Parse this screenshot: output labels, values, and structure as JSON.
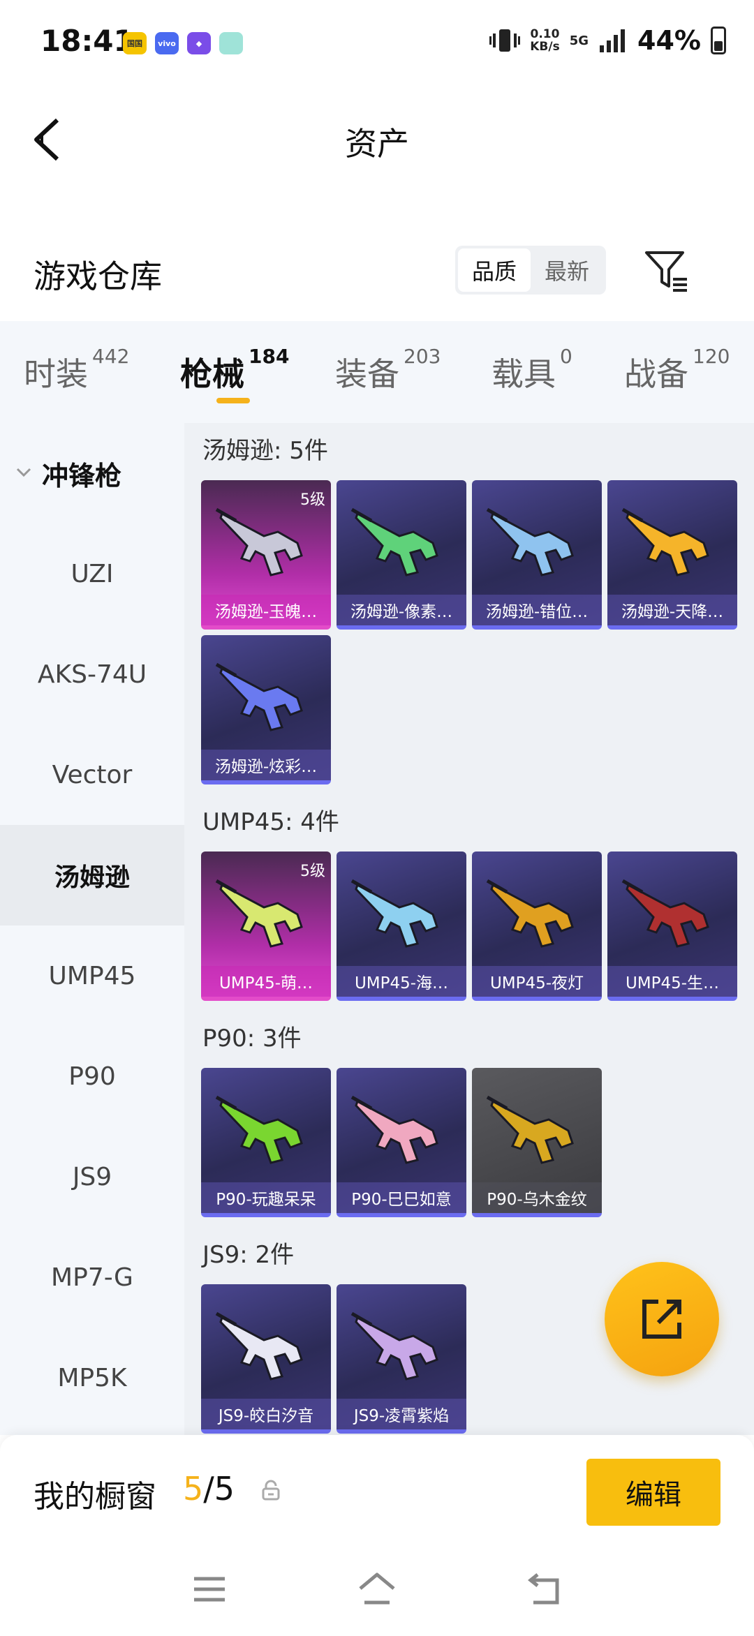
{
  "status": {
    "time": "18:41",
    "apps": [
      {
        "name": "app-icon-1",
        "label": "国国",
        "color": "#f5c400"
      },
      {
        "name": "app-icon-2",
        "label": "vivo",
        "color": "#4a6af0"
      },
      {
        "name": "app-icon-3",
        "label": "◆",
        "color": "#7a4de8"
      },
      {
        "name": "app-icon-4",
        "label": "",
        "color": "#9fe3d8"
      }
    ],
    "net_speed": "0.10",
    "net_unit": "KB/s",
    "network": "5G",
    "battery": "44%"
  },
  "header": {
    "title": "资产"
  },
  "warehouse": {
    "title": "游戏仓库",
    "sort_options": [
      "品质",
      "最新"
    ],
    "sort_active": "品质"
  },
  "tabs": [
    {
      "label": "时装",
      "count": "442"
    },
    {
      "label": "枪械",
      "count": "184"
    },
    {
      "label": "装备",
      "count": "203"
    },
    {
      "label": "载具",
      "count": "0"
    },
    {
      "label": "战备",
      "count": "120"
    }
  ],
  "sidebar": {
    "group": "冲锋枪",
    "items": [
      "UZI",
      "AKS-74U",
      "Vector",
      "汤姆逊",
      "UMP45",
      "P90",
      "JS9",
      "MP7-G",
      "MP5K"
    ],
    "active": "汤姆逊"
  },
  "groups": [
    {
      "title": "汤姆逊: 5件",
      "items": [
        {
          "name": "汤姆逊-玉魄…",
          "level": "5级",
          "rarity": "pink",
          "color": "#c8c8d8"
        },
        {
          "name": "汤姆逊-像素…",
          "level": "",
          "rarity": "purple",
          "color": "#5fd27a"
        },
        {
          "name": "汤姆逊-错位…",
          "level": "",
          "rarity": "purple",
          "color": "#8fc3ef"
        },
        {
          "name": "汤姆逊-天降…",
          "level": "",
          "rarity": "purple",
          "color": "#f5b42a"
        },
        {
          "name": "汤姆逊-炫彩…",
          "level": "",
          "rarity": "purple",
          "color": "#6a7af0"
        }
      ]
    },
    {
      "title": "UMP45: 4件",
      "items": [
        {
          "name": "UMP45-萌…",
          "level": "5级",
          "rarity": "pink",
          "color": "#d8e870"
        },
        {
          "name": "UMP45-海…",
          "level": "",
          "rarity": "purple",
          "color": "#8ed0f0"
        },
        {
          "name": "UMP45-夜灯",
          "level": "",
          "rarity": "purple",
          "color": "#e0a020"
        },
        {
          "name": "UMP45-生…",
          "level": "",
          "rarity": "purple",
          "color": "#b03030"
        }
      ]
    },
    {
      "title": "P90: 3件",
      "items": [
        {
          "name": "P90-玩趣呆呆",
          "level": "",
          "rarity": "purple",
          "color": "#7ad630"
        },
        {
          "name": "P90-巳巳如意",
          "level": "",
          "rarity": "purple",
          "color": "#f0a8c0"
        },
        {
          "name": "P90-乌木金纹",
          "level": "",
          "rarity": "gray",
          "color": "#d8a820"
        }
      ]
    },
    {
      "title": "JS9: 2件",
      "items": [
        {
          "name": "JS9-皎白汐音",
          "level": "",
          "rarity": "purple",
          "color": "#e8e8f4"
        },
        {
          "name": "JS9-凌霄紫焰",
          "level": "",
          "rarity": "purple",
          "color": "#c8a8e8"
        }
      ]
    }
  ],
  "showcase": {
    "label": "我的橱窗",
    "current": "5",
    "total": "/5",
    "edit_label": "编辑"
  },
  "colors": {
    "accent": "#f5b21b"
  }
}
